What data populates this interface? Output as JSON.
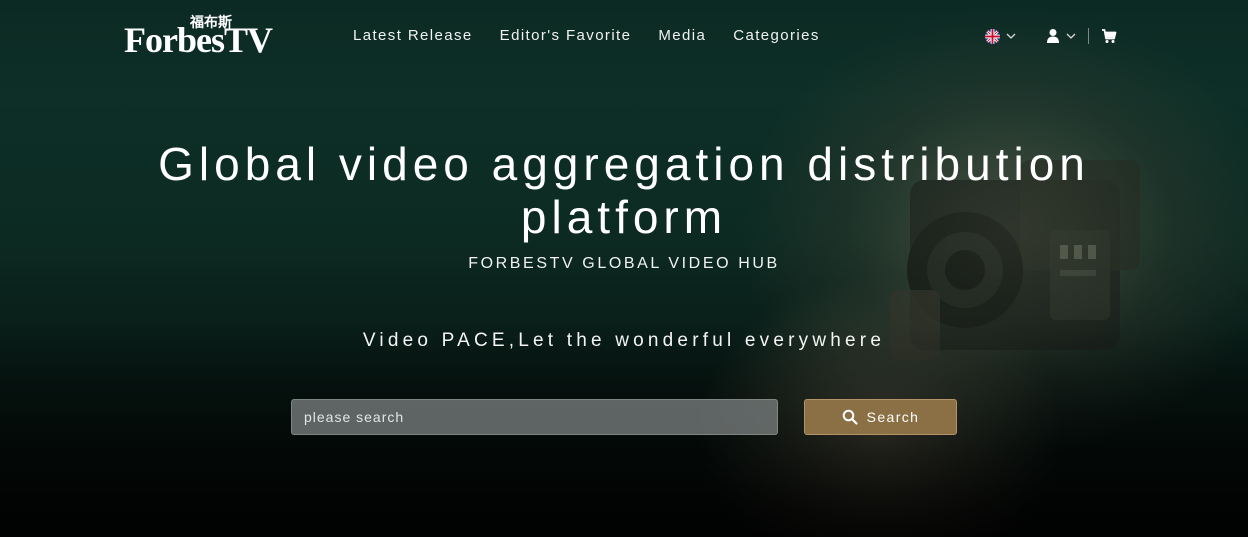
{
  "header": {
    "logo": {
      "chinese_text": "福布斯",
      "main_text": "ForbesTV"
    },
    "nav": [
      {
        "label": "Latest Release"
      },
      {
        "label": "Editor's Favorite"
      },
      {
        "label": "Media"
      },
      {
        "label": "Categories"
      }
    ],
    "icons": {
      "language": "uk-flag-icon",
      "language_dropdown": "chevron-down-icon",
      "user": "user-icon",
      "user_dropdown": "chevron-down-icon",
      "cart": "shopping-cart-icon"
    }
  },
  "hero": {
    "title": "Global video aggregation distribution platform",
    "subtitle": "FORBESTV GLOBAL VIDEO HUB",
    "tagline": "Video PACE,Let the wonderful everywhere"
  },
  "search": {
    "placeholder": "please search",
    "value": "",
    "button_label": "Search",
    "button_icon": "search-icon"
  },
  "colors": {
    "background_top": "#0b2a23",
    "background_bottom": "#030605",
    "search_button": "#8b6f45",
    "search_input": "#787d7d"
  }
}
